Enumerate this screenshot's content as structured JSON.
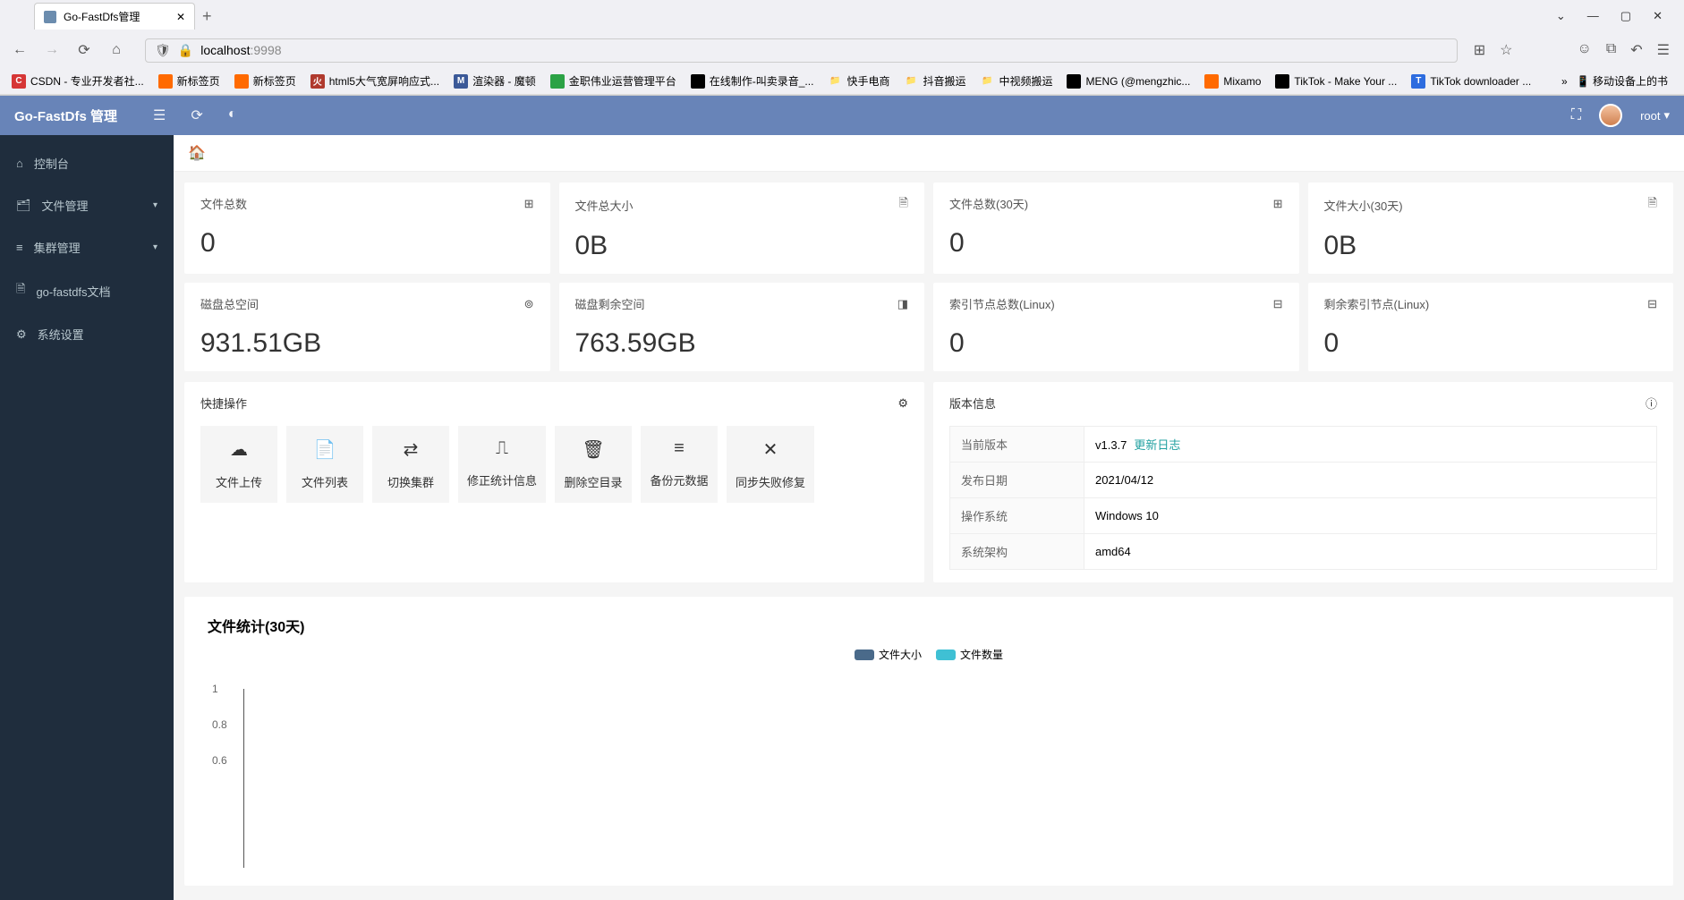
{
  "browser": {
    "tab_title": "Go-FastDfs管理",
    "url_host": "localhost",
    "url_port": ":9998",
    "window_controls": {
      "min": "—",
      "max": "▢",
      "close": "✕",
      "down": "⌄"
    }
  },
  "bookmarks": [
    {
      "label": "CSDN - 专业开发者社...",
      "color": "#d63636",
      "letter": "C"
    },
    {
      "label": "新标签页",
      "color": "#ff6a00",
      "letter": ""
    },
    {
      "label": "新标签页",
      "color": "#ff6a00",
      "letter": ""
    },
    {
      "label": "html5大气宽屏响应式...",
      "color": "#b03a2e",
      "letter": "火"
    },
    {
      "label": "渲染器 - 魔顿",
      "color": "#3b5998",
      "letter": "M"
    },
    {
      "label": "金职伟业运营管理平台",
      "color": "#2ba245",
      "letter": ""
    },
    {
      "label": "在线制作-叫卖录音_...",
      "color": "#000",
      "letter": ""
    },
    {
      "label": "快手电商",
      "color": "transparent",
      "letter": "📁"
    },
    {
      "label": "抖音搬运",
      "color": "transparent",
      "letter": "📁"
    },
    {
      "label": "中视频搬运",
      "color": "transparent",
      "letter": "📁"
    },
    {
      "label": "MENG (@mengzhic...",
      "color": "#000",
      "letter": ""
    },
    {
      "label": "Mixamo",
      "color": "#ff6a00",
      "letter": ""
    },
    {
      "label": "TikTok - Make Your ...",
      "color": "#000",
      "letter": ""
    },
    {
      "label": "TikTok downloader ...",
      "color": "#2d6cdf",
      "letter": "T"
    }
  ],
  "bookmarks_overflow": "移动设备上的书",
  "header": {
    "title": "Go-FastDfs 管理",
    "user": "root"
  },
  "sidebar": [
    {
      "icon": "dashboard",
      "label": "控制台",
      "expandable": false
    },
    {
      "icon": "file",
      "label": "文件管理",
      "expandable": true
    },
    {
      "icon": "cluster",
      "label": "集群管理",
      "expandable": true
    },
    {
      "icon": "doc",
      "label": "go-fastdfs文档",
      "expandable": false
    },
    {
      "icon": "settings",
      "label": "系统设置",
      "expandable": false
    }
  ],
  "stats": [
    {
      "label": "文件总数",
      "value": "0",
      "icon": "calc"
    },
    {
      "label": "文件总大小",
      "value": "0B",
      "icon": "filesize"
    },
    {
      "label": "文件总数(30天)",
      "value": "0",
      "icon": "calc"
    },
    {
      "label": "文件大小(30天)",
      "value": "0B",
      "icon": "filesize"
    },
    {
      "label": "磁盘总空间",
      "value": "931.51GB",
      "icon": "disk"
    },
    {
      "label": "磁盘剩余空间",
      "value": "763.59GB",
      "icon": "cube"
    },
    {
      "label": "索引节点总数(Linux)",
      "value": "0",
      "icon": "tree"
    },
    {
      "label": "剩余索引节点(Linux)",
      "value": "0",
      "icon": "tree"
    }
  ],
  "quick": {
    "title": "快捷操作",
    "actions": [
      {
        "icon": "☁",
        "label": "文件上传"
      },
      {
        "icon": "📄",
        "label": "文件列表"
      },
      {
        "icon": "⇄",
        "label": "切换集群"
      },
      {
        "icon": "⎍",
        "label": "修正统计信息"
      },
      {
        "icon": "🗑",
        "label": "删除空目录"
      },
      {
        "icon": "≡",
        "label": "备份元数据"
      },
      {
        "icon": "✕",
        "label": "同步失败修复"
      }
    ]
  },
  "version": {
    "title": "版本信息",
    "rows": [
      {
        "k": "当前版本",
        "v": "v1.3.7",
        "link": "更新日志"
      },
      {
        "k": "发布日期",
        "v": "2021/04/12"
      },
      {
        "k": "操作系统",
        "v": "Windows 10"
      },
      {
        "k": "系统架构",
        "v": "amd64"
      }
    ]
  },
  "chart_data": {
    "type": "line",
    "title": "文件统计(30天)",
    "series": [
      {
        "name": "文件大小",
        "color": "#4a6a8a",
        "values": []
      },
      {
        "name": "文件数量",
        "color": "#3fc0d4",
        "values": []
      }
    ],
    "ylim": [
      0,
      1
    ],
    "y_ticks": [
      1,
      0.8,
      0.6
    ],
    "xlabel": "",
    "ylabel": ""
  }
}
